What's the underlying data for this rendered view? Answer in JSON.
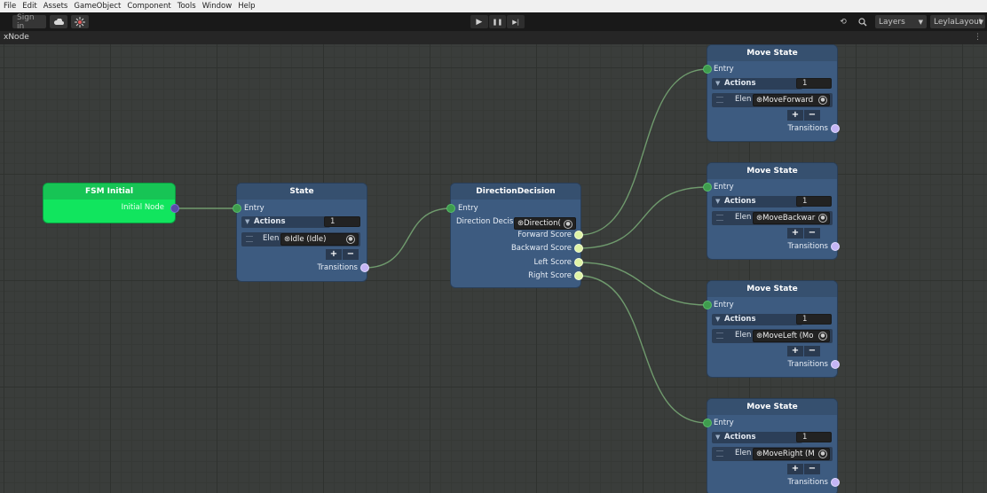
{
  "menu": [
    "File",
    "Edit",
    "Assets",
    "GameObject",
    "Component",
    "Tools",
    "Window",
    "Help"
  ],
  "toolbar": {
    "sign_in": "Sign in",
    "play_icon": "▶",
    "pause_icon": "❚❚",
    "step_icon": "▶|",
    "history_icon": "⟲",
    "search_icon": "🔍",
    "layers": "Layers",
    "layout": "LeylaLayout"
  },
  "window": {
    "title": "xNode",
    "menu_icon": "⋮"
  },
  "colors": {
    "node": "#3d5b80",
    "initial_node": "#11e55e",
    "wire": "#6f9a6d",
    "grid": "#3a3d3b"
  },
  "nodes": {
    "initial": {
      "title": "FSM Initial",
      "output": "Initial Node"
    },
    "state": {
      "title": "State",
      "entry": "Entry",
      "actions": "Actions",
      "count": "1",
      "element_label": "Elen",
      "element_value": "⊛Idle (Idle)",
      "plus": "+",
      "minus": "−",
      "transitions": "Transitions"
    },
    "decision": {
      "title": "DirectionDecision",
      "entry": "Entry",
      "decision_label": "Direction Decis",
      "decision_value": "⊛Direction(",
      "forward": "Forward Score",
      "backward": "Backward Score",
      "left": "Left Score",
      "right": "Right Score"
    },
    "moves": [
      {
        "title": "Move State",
        "entry": "Entry",
        "actions": "Actions",
        "count": "1",
        "element_label": "Elen",
        "element_value": "⊛MoveForward",
        "plus": "+",
        "minus": "−",
        "transitions": "Transitions"
      },
      {
        "title": "Move State",
        "entry": "Entry",
        "actions": "Actions",
        "count": "1",
        "element_label": "Elen",
        "element_value": "⊛MoveBackwar",
        "plus": "+",
        "minus": "−",
        "transitions": "Transitions"
      },
      {
        "title": "Move State",
        "entry": "Entry",
        "actions": "Actions",
        "count": "1",
        "element_label": "Elen",
        "element_value": "⊛MoveLeft (Mo",
        "plus": "+",
        "minus": "−",
        "transitions": "Transitions"
      },
      {
        "title": "Move State",
        "entry": "Entry",
        "actions": "Actions",
        "count": "1",
        "element_label": "Elen",
        "element_value": "⊛MoveRight (M",
        "plus": "+",
        "minus": "−",
        "transitions": "Transitions"
      }
    ]
  }
}
